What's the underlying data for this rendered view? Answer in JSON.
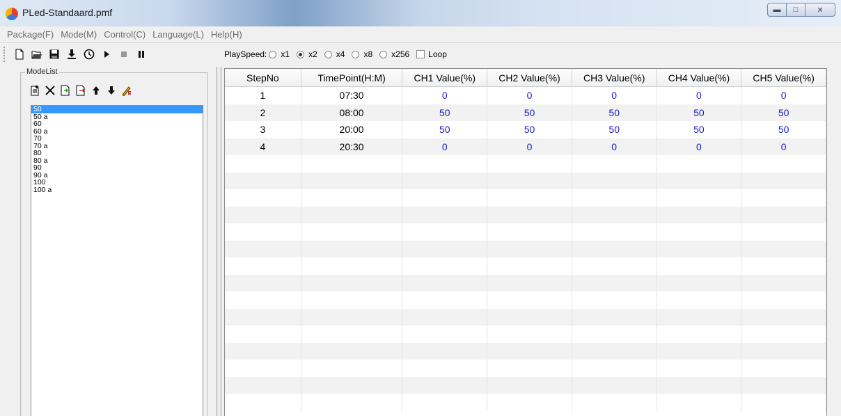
{
  "window": {
    "title": "PLed-Standaard.pmf"
  },
  "menu": [
    "Package(F)",
    "Mode(M)",
    "Control(C)",
    "Language(L)",
    "Help(H)"
  ],
  "toolbar": {
    "icons": [
      "new-file-icon",
      "open-folder-icon",
      "save-icon",
      "download-icon",
      "clock-icon",
      "play-icon",
      "stop-icon",
      "pause-icon"
    ]
  },
  "playspeed": {
    "label": "PlaySpeed:",
    "options": [
      "x1",
      "x2",
      "x4",
      "x8",
      "x256"
    ],
    "selected": "x2",
    "loop_label": "Loop",
    "loop_checked": false
  },
  "modelist": {
    "title": "ModeList",
    "tools": [
      "new-mode-icon",
      "delete-icon",
      "import-icon",
      "export-icon",
      "move-up-icon",
      "move-down-icon",
      "edit-icon"
    ],
    "items": [
      "50",
      "50 a",
      "60",
      "60 a",
      "70",
      "70 a",
      "80",
      "80 a",
      "90",
      "90 a",
      "100",
      "100 a"
    ],
    "selected_index": 0
  },
  "grid": {
    "columns": [
      "StepNo",
      "TimePoint(H:M)",
      "CH1 Value(%)",
      "CH2 Value(%)",
      "CH3 Value(%)",
      "CH4 Value(%)",
      "CH5 Value(%)"
    ],
    "rows": [
      [
        "1",
        "07:30",
        "0",
        "0",
        "0",
        "0",
        "0"
      ],
      [
        "2",
        "08:00",
        "50",
        "50",
        "50",
        "50",
        "50"
      ],
      [
        "3",
        "20:00",
        "50",
        "50",
        "50",
        "50",
        "50"
      ],
      [
        "4",
        "20:30",
        "0",
        "0",
        "0",
        "0",
        "0"
      ]
    ],
    "empty_rows": 15
  },
  "colors": {
    "selection": "#3399ff",
    "value_text": "#1a1ac8"
  }
}
